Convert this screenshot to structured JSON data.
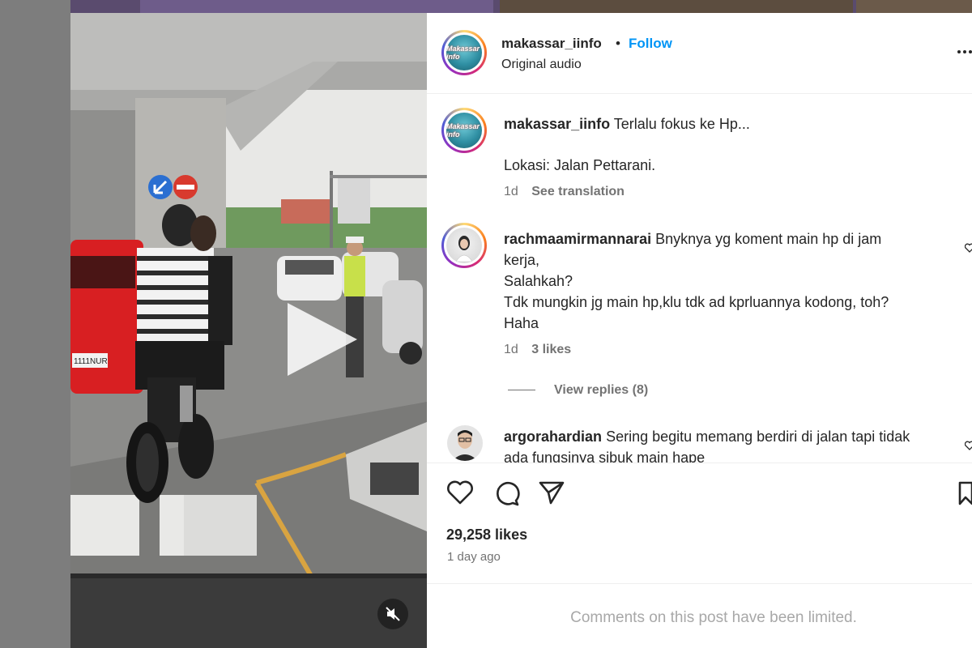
{
  "post": {
    "author": "makassar_iinfo",
    "separator": "•",
    "follow_label": "Follow",
    "audio": "Original audio",
    "avatar_text": "Makassar info"
  },
  "caption": {
    "username": "makassar_iinfo",
    "line1": "Terlalu fokus ke Hp...",
    "line2": "Lokasi: Jalan Pettarani.",
    "time": "1d",
    "translate_label": "See translation"
  },
  "comments": [
    {
      "username": "rachmaamirmannarai",
      "lines": [
        "Bnyknya yg koment main hp di jam",
        "kerja,",
        "Salahkah?",
        "Tdk mungkin jg main hp,klu tdk ad kprluannya kodong, toh?",
        "Haha"
      ],
      "time": "1d",
      "likes_label": "3 likes",
      "view_replies": "View replies (8)"
    },
    {
      "username": "argorahardian",
      "lines": [
        "Sering begitu memang berdiri di jalan tapi tidak",
        "ada fungsinya sibuk main hape"
      ]
    }
  ],
  "stats": {
    "likes": "29,258 likes",
    "posted": "1 day ago"
  },
  "footer": {
    "limited": "Comments on this post have been limited."
  },
  "video_overlay": {
    "plate": "1111NUR"
  },
  "colors": {
    "accent": "#0095f6",
    "muted": "#737373"
  }
}
